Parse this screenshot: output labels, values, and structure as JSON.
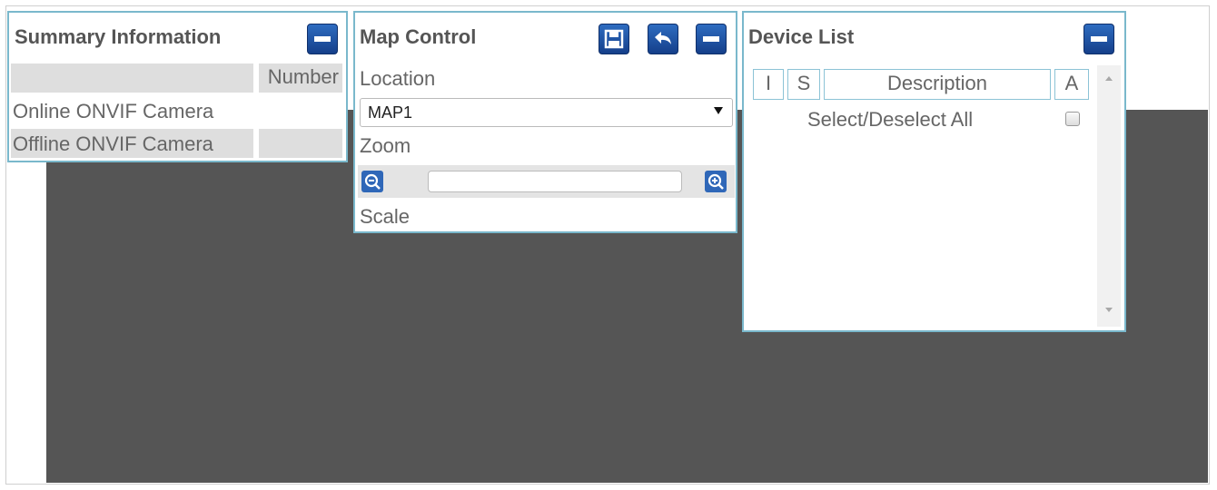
{
  "summary": {
    "title": "Summary Information",
    "column_header": "Number",
    "rows": [
      {
        "label": "Online ONVIF Camera",
        "value": ""
      },
      {
        "label": "Offline ONVIF Camera",
        "value": ""
      }
    ]
  },
  "map_control": {
    "title": "Map Control",
    "location_label": "Location",
    "location_value": "MAP1",
    "zoom_label": "Zoom",
    "scale_label": "Scale"
  },
  "device_list": {
    "title": "Device List",
    "columns": [
      "I",
      "S",
      "Description",
      "A"
    ],
    "select_all_label": "Select/Deselect All"
  },
  "icons": {
    "minimize": "minus-icon",
    "save": "floppy-disk-icon",
    "back": "undo-arrow-icon",
    "zoom_out": "zoom-out-icon",
    "zoom_in": "zoom-in-icon"
  },
  "colors": {
    "accent_border": "#7ab8cc",
    "button_blue": "#1f55a6",
    "map_background": "#555555"
  }
}
